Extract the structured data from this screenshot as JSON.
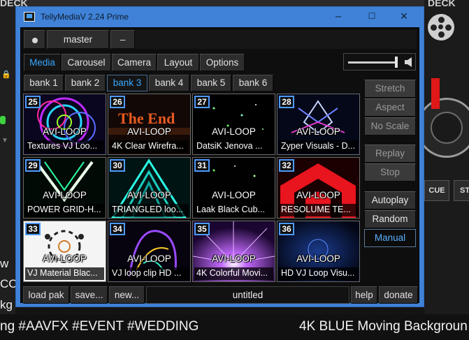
{
  "host_app": {
    "deck_left": "DECK",
    "deck_right": "DECK",
    "side_text": [
      "w",
      "CC",
      "kg"
    ],
    "cue_label": "CUE",
    "st_label": "ST",
    "caption_left": "ng #AAVFX #EVENT #WEDDING",
    "caption_right": "4K BLUE Moving Backgroun"
  },
  "window": {
    "title": "TellyMediaV 2.24 Prime",
    "controls": {
      "minimize": "–",
      "maximize": "☐",
      "close": "×"
    }
  },
  "topbar": {
    "channel": "master",
    "minus": "–"
  },
  "tabs": [
    {
      "label": "Media",
      "active": true
    },
    {
      "label": "Carousel",
      "active": false
    },
    {
      "label": "Camera",
      "active": false
    },
    {
      "label": "Layout",
      "active": false
    },
    {
      "label": "Options",
      "active": false
    }
  ],
  "volume": {
    "level": 0.95
  },
  "banks": [
    {
      "label": "bank 1",
      "selected": false
    },
    {
      "label": "bank 2",
      "selected": false
    },
    {
      "label": "bank 3",
      "selected": true
    },
    {
      "label": "bank 4",
      "selected": false
    },
    {
      "label": "bank 5",
      "selected": false
    },
    {
      "label": "bank 6",
      "selected": false
    }
  ],
  "media": [
    {
      "num": "25",
      "type": "AVI-LOOP",
      "name": "Textures VJ Loo..."
    },
    {
      "num": "26",
      "type": "AVI-LOOP",
      "name": "4K Clear Wirefra..."
    },
    {
      "num": "27",
      "type": "AVI-LOOP",
      "name": "DatsiK   Jenova ..."
    },
    {
      "num": "28",
      "type": "AVI-LOOP",
      "name": "Zyper Visuals - D..."
    },
    {
      "num": "29",
      "type": "AVI-LOOP",
      "name": "POWER GRID-H..."
    },
    {
      "num": "30",
      "type": "AVI-LOOP",
      "name": "TRIANGLED loo..."
    },
    {
      "num": "31",
      "type": "AVI-LOOP",
      "name": "Laak Black Cub..."
    },
    {
      "num": "32",
      "type": "AVI-LOOP",
      "name": "RESOLUME TE..."
    },
    {
      "num": "33",
      "type": "AVI-LOOP",
      "name": "VJ Material  Blac..."
    },
    {
      "num": "34",
      "type": "AVI-LOOP",
      "name": "VJ loop clip HD ..."
    },
    {
      "num": "35",
      "type": "AVI-LOOP",
      "name": "4K Colorful Movi..."
    },
    {
      "num": "36",
      "type": "AVI-LOOP",
      "name": "HD VJ Loop Visu..."
    }
  ],
  "thumb_art": {
    "thumb_26_text": "The End"
  },
  "side_buttons": {
    "stretch": "Stretch",
    "aspect": "Aspect",
    "no_scale": "No Scale",
    "replay": "Replay",
    "stop": "Stop",
    "autoplay": "Autoplay",
    "random": "Random",
    "manual": "Manual"
  },
  "bottom": {
    "load_pak": "load pak",
    "save": "save...",
    "new": "new...",
    "pak_name": "untitled",
    "help": "help",
    "donate": "donate"
  },
  "colors": {
    "accent": "#39a8ff",
    "window_frame": "#3f82d8",
    "number_border": "#4d9bff"
  }
}
